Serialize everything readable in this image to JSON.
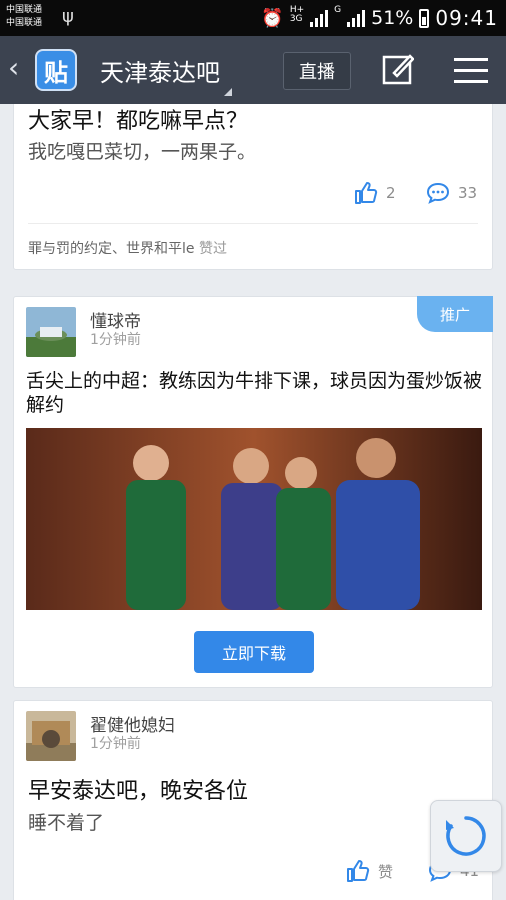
{
  "status_bar": {
    "carrier1": "中国联通",
    "carrier2": "中国联通",
    "net1": "H+",
    "net1b": "3G",
    "net2": "G",
    "battery": "51%",
    "time": "09:41"
  },
  "nav": {
    "title": "天津泰达吧",
    "logo_char": "贴",
    "live_label": "直播"
  },
  "posts": [
    {
      "title": "大家早！都吃嘛早点？",
      "body": "我吃嘎巴菜切，一两果子。",
      "likes": "2",
      "comments": "33",
      "liked_by": "罪与罚的约定、世界和平le",
      "liked_suffix": "赞过"
    },
    {
      "username": "懂球帝",
      "time": "1分钟前",
      "promo_tag": "推广",
      "headline": "舌尖上的中超：教练因为牛排下课，球员因为蛋炒饭被解约",
      "download_label": "立即下载"
    },
    {
      "username": "翟健他媳妇",
      "time": "1分钟前",
      "title": "早安泰达吧，晚安各位",
      "body": "睡不着了",
      "likes": "赞",
      "comments": "41"
    }
  ],
  "colors": {
    "nav_bg": "#3c4350",
    "accent": "#3388e8",
    "promo": "#6ab2f0"
  }
}
